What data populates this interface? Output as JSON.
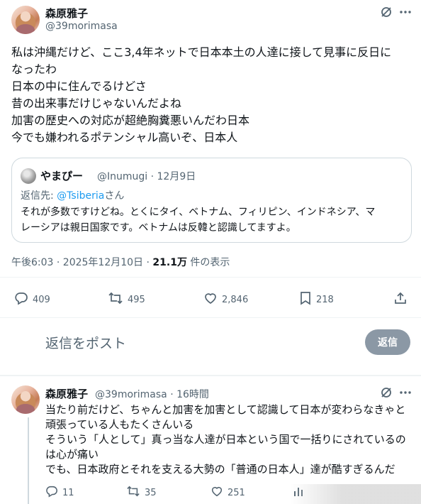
{
  "main_tweet": {
    "author_name": "森原雅子",
    "handle": "@39morimasa",
    "lines": [
      "私は沖縄だけど、ここ3,4年ネットで日本本土の人達に接して見事に反日に",
      "なったわ",
      "日本の中に住んでるけどさ",
      "昔の出来事だけじゃないんだよね",
      "加害の歴史への対応が超絶胸糞悪いんだわ日本",
      "今でも嫌われるポテンシャル高いぞ、日本人"
    ],
    "quote": {
      "author_name": "やまぴー",
      "handle_date": "@Inumugi · 12月9日",
      "reply_prefix": "返信先: ",
      "reply_to": "@Tsiberia",
      "reply_suffix": "さん",
      "lines": [
        "それが多数ですけどね。とくにタイ、ベトナム、フィリピン、インドネシア、マ",
        "レーシアは親日国家です。ベトナムは反韓と認識してますよ。"
      ]
    },
    "timestamp": "午後6:03 · 2025年12月10日 · ",
    "views_count": "21.1万",
    "views_suffix": " 件の表示",
    "stats": {
      "replies": "409",
      "retweets": "495",
      "likes": "2,846",
      "bookmarks": "218"
    }
  },
  "composer": {
    "placeholder": "返信をポスト",
    "button_label": "返信"
  },
  "reply_tweet": {
    "author_name": "森原雅子",
    "handle_time": "@39morimasa · 16時間",
    "lines": [
      "当たり前だけど、ちゃんと加害を加害として認識して日本が変わらなきゃと",
      "頑張っている人もたくさんいる",
      "そういう「人として」真っ当な人達が日本という国で一括りにされているの",
      "は心が痛い",
      "でも、日本政府とそれを支える大勢の「普通の日本人」達が酷すぎるんだ"
    ],
    "stats": {
      "replies": "11",
      "retweets": "35",
      "likes": "251"
    }
  },
  "icons": [
    "grok-icon",
    "more-icon",
    "reply-icon",
    "retweet-icon",
    "like-icon",
    "bookmark-icon",
    "share-icon",
    "views-icon"
  ]
}
